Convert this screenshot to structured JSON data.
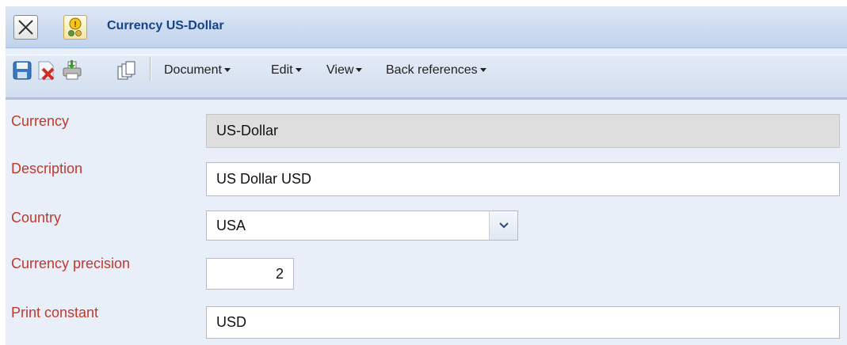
{
  "window": {
    "title": "Currency US-Dollar"
  },
  "toolbar": {
    "icons": [
      "save-icon",
      "delete-icon",
      "print-icon",
      "copy-icon"
    ],
    "menus": [
      {
        "label": "Document"
      },
      {
        "label": "Edit"
      },
      {
        "label": "View"
      },
      {
        "label": "Back references"
      }
    ]
  },
  "form": {
    "currency": {
      "label": "Currency",
      "value": "US-Dollar"
    },
    "description": {
      "label": "Description",
      "value": "US Dollar USD"
    },
    "country": {
      "label": "Country",
      "value": "USA"
    },
    "precision": {
      "label": "Currency precision",
      "value": "2"
    },
    "print_constant": {
      "label": "Print constant",
      "value": "USD"
    }
  },
  "colors": {
    "label": "#c0392b",
    "title": "#15428b",
    "toolbar_border": "#a8c2e6"
  }
}
